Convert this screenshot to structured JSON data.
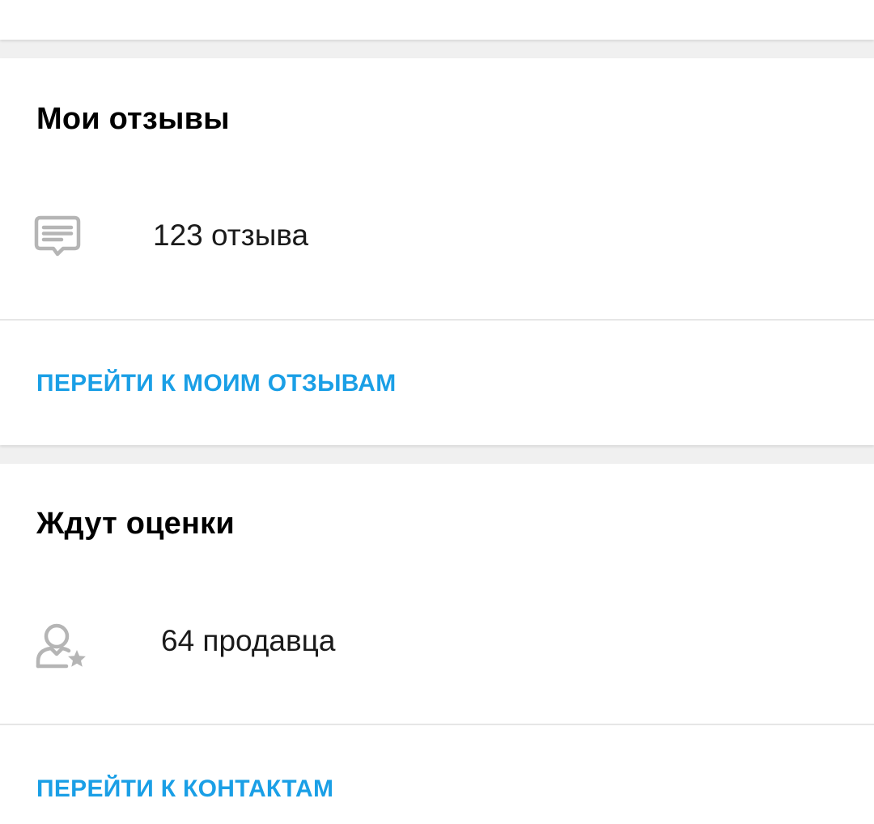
{
  "colors": {
    "link": "#1a9fe6",
    "icon": "#b5b5b5",
    "divider": "#e6e6e6",
    "background": "#f0f0f0"
  },
  "reviews": {
    "title": "Мои отзывы",
    "icon": "chat-message-icon",
    "count_text": "123 отзыва",
    "link_label": "ПЕРЕЙТИ К МОИМ ОТЗЫВАМ"
  },
  "pending": {
    "title": "Ждут оценки",
    "icon": "user-star-icon",
    "count_text": "64 продавца",
    "link_label": "ПЕРЕЙТИ К КОНТАКТАМ"
  }
}
